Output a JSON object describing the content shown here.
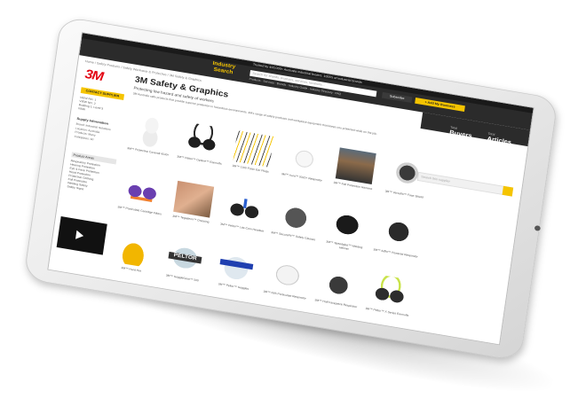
{
  "site": {
    "logo_line1": "Industry",
    "logo_line2": "Search",
    "top_strip": "Trusted by 400,000+ Australia industrial buyers. 1000's of industrial brands",
    "search_placeholder": "Search for brands, products, services, locations...",
    "subscribe_label": "Subscribe",
    "add_business_label": "+ Add My Business",
    "nav_items": [
      "Products",
      "Services",
      "Brands",
      "Industry Guide",
      "Industry Directory",
      "FAQ"
    ]
  },
  "breadcrumb": "Home  /  Safety Products  /  Safety Workwear & Protective  /  3M Safety & Graphics",
  "company": {
    "brand_mark": "3M",
    "title": "3M Safety & Graphics",
    "tagline": "Protecting low hazard and safety of workers",
    "description": "3M Australia sells products that provide superior protection in hazardous environments. 3M's range of safety products and workplace equipment that keeps you protected while on the job."
  },
  "stats": [
    {
      "label": "Total",
      "value": "Buyers"
    },
    {
      "label": "Total",
      "value": "Articles"
    }
  ],
  "sidebar": {
    "contact_button": "CONTACT SUPPLIER",
    "contact_lines": [
      "VIEW NO. 1",
      "VIEW NO. 2",
      "Building 1, Level 3",
      "NSW"
    ],
    "quick_title": "Supply Information",
    "quick_lines": [
      "Brand: Industrial Solutions",
      "Location: Australia",
      "Products: Many",
      "Categories: 60"
    ],
    "product_areas_title": "Product Areas",
    "product_areas": [
      "Respiratory Protection",
      "Hearing Protection",
      "Eye & Face Protection",
      "Head Protection",
      "Protective Clothing",
      "Fall Protection",
      "Welding Safety",
      "Safety Signs"
    ]
  },
  "company_search_placeholder": "Search this supplier",
  "products": [
    {
      "img": "coverall",
      "caption": "3M™ Protective Coverall 4540+"
    },
    {
      "img": "earmuff",
      "caption": "3M™ Peltor™ Optime™ Earmuffs"
    },
    {
      "img": "pens",
      "caption": "3M™ 1100 Foam Ear Plugs"
    },
    {
      "img": "mask",
      "caption": "3M™ Aura™ 9320+ Respirator"
    },
    {
      "img": "worker",
      "caption": "3M™ Fall Protection Harness"
    },
    {
      "img": "faceshield",
      "caption": "3M™ Versaflo™ Face Shield"
    },
    {
      "img": "filters",
      "caption": "3M™ Particulate Cartridge Filters"
    },
    {
      "img": "bandage",
      "caption": "3M™ Tegaderm™ Dressing"
    },
    {
      "img": "headset2",
      "caption": "3M™ Peltor™ Lite-Com Headset"
    },
    {
      "img": "glasses",
      "caption": "3M™ SecureFit™ Safety Glasses"
    },
    {
      "img": "weldhelm",
      "caption": "3M™ Speedglas™ Welding Helmet"
    },
    {
      "img": "respirator",
      "caption": "3M™ Adflo™ Powered Respirator"
    },
    {
      "img": "hardhat",
      "caption": "3M™ Hard Hat"
    },
    {
      "img": "goggles1",
      "caption": "3M™ GoggleGear™ 500"
    },
    {
      "img": "goggles2",
      "caption": "3M™ Peltor™ Goggles"
    },
    {
      "img": "n95",
      "caption": "3M™ N95 Particulate Respirator"
    },
    {
      "img": "halfmask",
      "caption": "3M™ Half Facepiece Respirator"
    },
    {
      "img": "earmuff2",
      "caption": "3M™ Peltor™ X Series Earmuffs"
    }
  ],
  "pelt_badge": "PELTOR",
  "video_label": "3M Video",
  "colors": {
    "accent": "#f5c400",
    "brand_red": "#e30613",
    "header": "#2b2b2b"
  }
}
